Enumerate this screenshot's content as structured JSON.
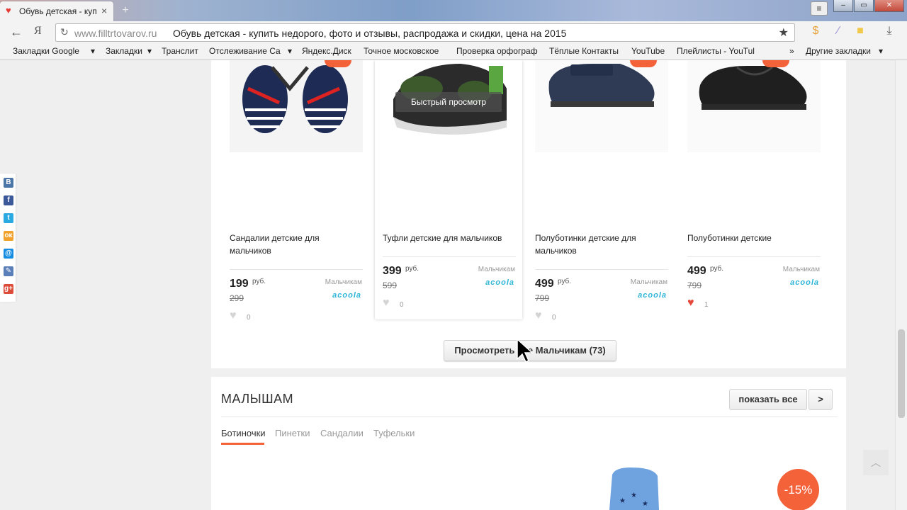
{
  "browser": {
    "tab_title": "Обувь детская - купить недорого",
    "tab_close": "×",
    "new_tab": "+",
    "window_min": "–",
    "window_max": "▭",
    "window_close": "✕",
    "menu": "≡",
    "back": "←",
    "yandex": "Я",
    "reload": "↻",
    "url_domain": "www.filltrtovarov.ru",
    "url_title": "Обувь детская - купить недорого, фото и отзывы, распродажа и скидки, цена на 2015",
    "star": "★",
    "download": "⤓"
  },
  "bookmarks": [
    "Закладки Google",
    "Закладки",
    "Транслит",
    "Отслеживание Са",
    "Яндекс.Диск",
    "Точное московское",
    "Проверка орфограф",
    "Тёплые Контакты",
    "YouTube",
    "Плейлисты - YouTul",
    "Другие закладки"
  ],
  "bookmark_arrow": "▾",
  "bookmark_more": "»",
  "social": [
    "В",
    "f",
    "t",
    "ок",
    "@",
    "✎",
    "g+"
  ],
  "products": [
    {
      "name": "Сандалии детские для мальчиков",
      "price": "199",
      "currency": "руб.",
      "old_price": "299",
      "category": "Мальчикам",
      "brand": "acoola",
      "likes": "0",
      "liked": false
    },
    {
      "name": "Туфли детские для мальчиков",
      "price": "399",
      "currency": "руб.",
      "old_price": "599",
      "category": "Мальчикам",
      "brand": "acoola",
      "likes": "0",
      "liked": false
    },
    {
      "name": "Полуботинки детские для мальчиков",
      "price": "499",
      "currency": "руб.",
      "old_price": "799",
      "category": "Мальчикам",
      "brand": "acoola",
      "likes": "0",
      "liked": false
    },
    {
      "name": "Полуботинки детские",
      "price": "499",
      "currency": "руб.",
      "old_price": "799",
      "category": "Мальчикам",
      "brand": "acoola",
      "likes": "1",
      "liked": true
    }
  ],
  "quick_view": "Быстрый просмотр",
  "view_all_button": "Просмотреть все Мальчикам (73)",
  "section": {
    "title": "МАЛЫШАМ",
    "show_all": "показать все",
    "next": ">",
    "tabs": [
      "Ботиночки",
      "Пинетки",
      "Сандалии",
      "Туфельки"
    ],
    "active_tab": 0,
    "discount_badge": "-15%"
  },
  "back_to_top": "︿",
  "heart": "♥",
  "colors": {
    "accent": "#f4623a",
    "brand": "#2fb5d8",
    "heart_on": "#e5483a"
  }
}
